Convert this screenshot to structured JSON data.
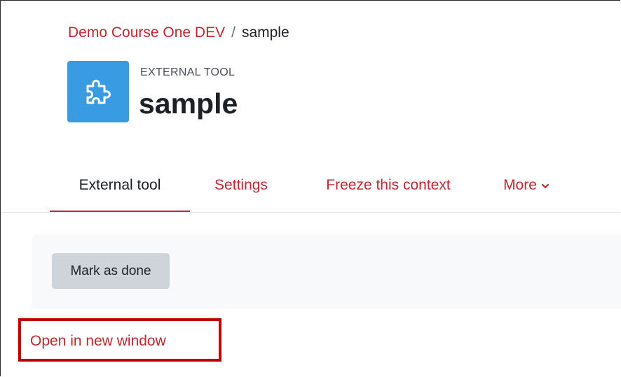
{
  "breadcrumb": {
    "course": "Demo Course One DEV",
    "separator": "/",
    "current": "sample"
  },
  "activity": {
    "icon": "puzzle-piece-icon",
    "icon_bg_color": "#399be2",
    "type": "EXTERNAL TOOL",
    "title": "sample"
  },
  "tabs": [
    {
      "label": "External tool",
      "active": true
    },
    {
      "label": "Settings",
      "active": false
    },
    {
      "label": "Freeze this context",
      "active": false
    },
    {
      "label": "More",
      "active": false,
      "icon": "chevron-down-icon"
    }
  ],
  "completion": {
    "mark_done_label": "Mark as done"
  },
  "launch": {
    "open_new_window_label": "Open in new window",
    "highlight_color": "#c20000"
  },
  "colors": {
    "accent": "#c4262e",
    "text": "#1d2125"
  }
}
